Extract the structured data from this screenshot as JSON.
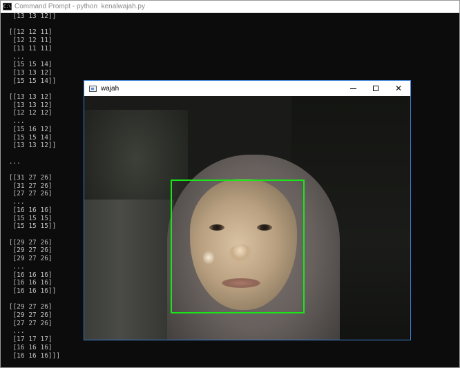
{
  "cmd": {
    "title": "Command Prompt - python  kenalwajah.py",
    "icon": "cmd-icon",
    "icon_text": "C:\\",
    "output": "  [13 13 12]]\n\n [[12 12 11]\n  [12 12 11]\n  [11 11 11]\n  ...\n  [15 15 14]\n  [13 13 12]\n  [15 15 14]]\n\n [[13 13 12]\n  [13 13 12]\n  [12 12 12]\n  ...\n  [15 16 12]\n  [15 15 14]\n  [13 13 12]]\n\n ...\n\n [[31 27 26]\n  [31 27 26]\n  [27 27 26]\n  ...\n  [16 16 16]\n  [15 15 15]\n  [15 15 15]]\n\n [[29 27 26]\n  [29 27 26]\n  [29 27 26]\n  ...\n  [16 16 16]\n  [16 16 16]\n  [16 16 16]]\n\n [[29 27 26]\n  [29 27 26]\n  [27 27 26]\n  ...\n  [17 17 17]\n  [16 16 16]\n  [16 16 16]]]"
  },
  "wajah": {
    "title": "wajah",
    "icon": "image-window-icon",
    "buttons": {
      "minimize": "minimize-icon",
      "maximize": "maximize-icon",
      "close_glyph": "✕"
    },
    "detection_box_color": "#19e619"
  }
}
